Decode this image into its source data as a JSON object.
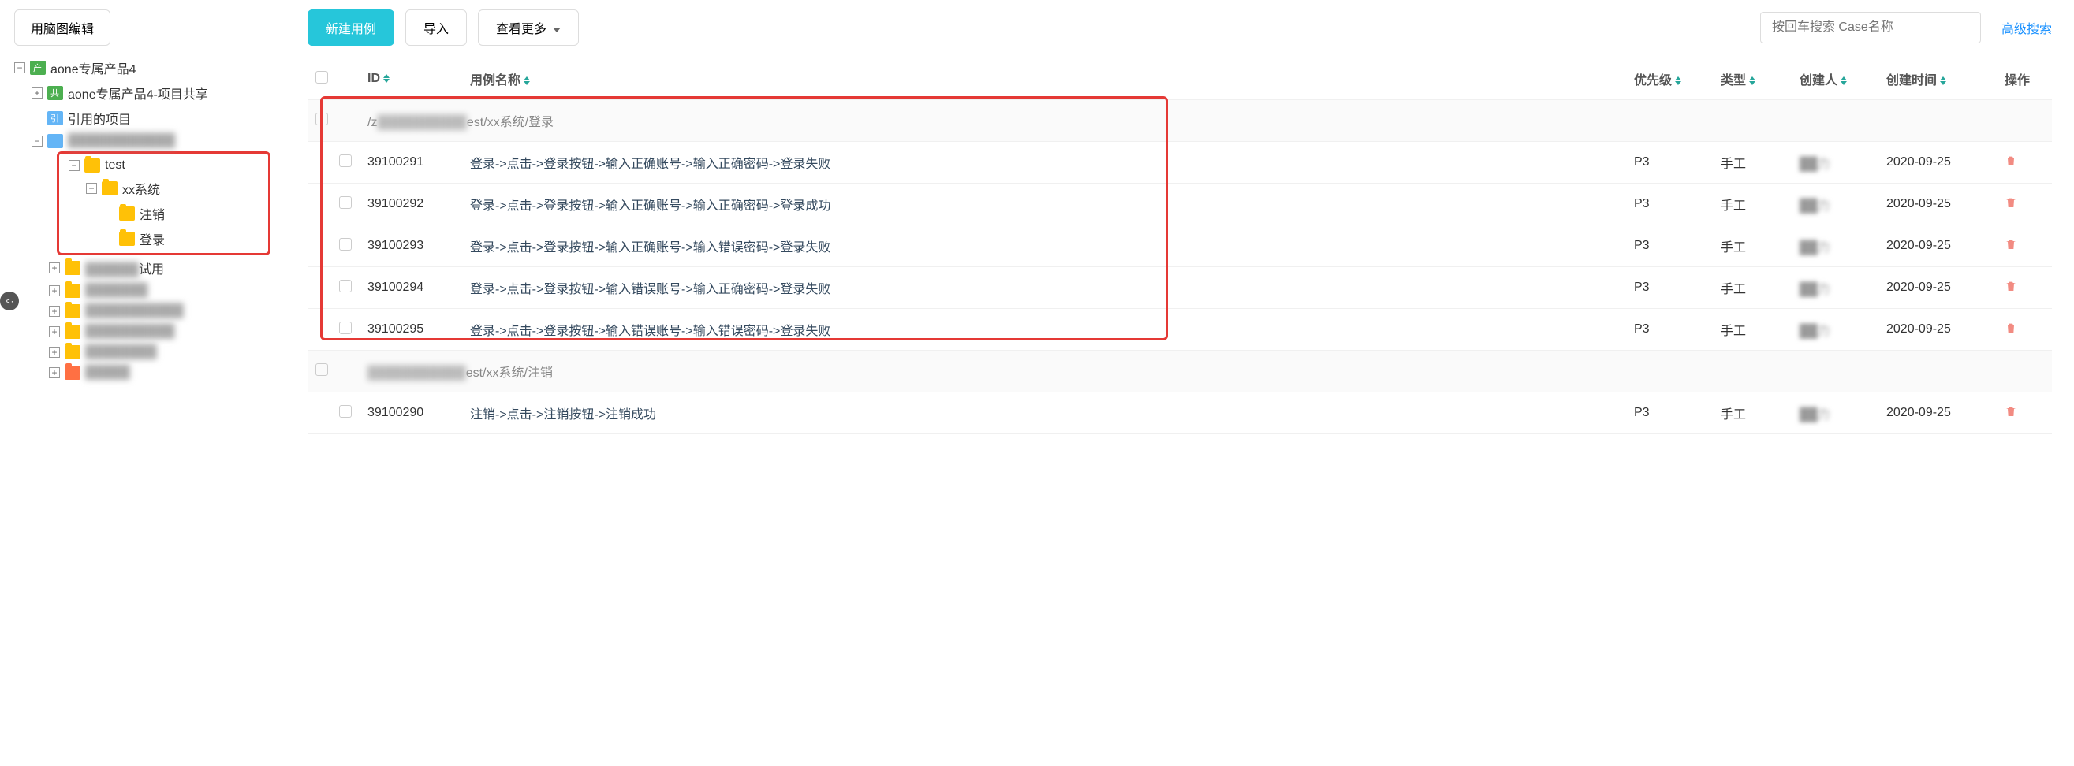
{
  "sidebar": {
    "mindmap_button": "用脑图编辑",
    "tree": {
      "root": "aone专属产品4",
      "share": "aone专属产品4-项目共享",
      "ref": "引用的项目",
      "blurred1": "████████████",
      "test": "test",
      "xxsys": "xx系统",
      "logout": "注销",
      "login": "登录",
      "other1_suffix": "试用",
      "blurred_others": [
        "███████",
        "███████████",
        "██████████",
        "████████",
        "█████"
      ]
    }
  },
  "toolbar": {
    "new_case": "新建用例",
    "import": "导入",
    "view_more": "查看更多",
    "search_placeholder": "按回车搜索 Case名称",
    "adv_search": "高级搜索"
  },
  "table": {
    "headers": {
      "id": "ID",
      "name": "用例名称",
      "priority": "优先级",
      "type": "类型",
      "creator": "创建人",
      "created_at": "创建时间",
      "op": "操作"
    },
    "groups": [
      {
        "path_prefix": "/z",
        "path_blurred": "██████████",
        "path_suffix": "est/xx系统/登录",
        "rows": [
          {
            "id": "39100291",
            "name": "登录->点击->登录按钮->输入正确账号->输入正确密码->登录失败",
            "priority": "P3",
            "type": "手工",
            "creator": "██力",
            "created_at": "2020-09-25"
          },
          {
            "id": "39100292",
            "name": "登录->点击->登录按钮->输入正确账号->输入正确密码->登录成功",
            "priority": "P3",
            "type": "手工",
            "creator": "██力",
            "created_at": "2020-09-25"
          },
          {
            "id": "39100293",
            "name": "登录->点击->登录按钮->输入正确账号->输入错误密码->登录失败",
            "priority": "P3",
            "type": "手工",
            "creator": "██力",
            "created_at": "2020-09-25"
          },
          {
            "id": "39100294",
            "name": "登录->点击->登录按钮->输入错误账号->输入正确密码->登录失败",
            "priority": "P3",
            "type": "手工",
            "creator": "██力",
            "created_at": "2020-09-25"
          },
          {
            "id": "39100295",
            "name": "登录->点击->登录按钮->输入错误账号->输入错误密码->登录失败",
            "priority": "P3",
            "type": "手工",
            "creator": "██力",
            "created_at": "2020-09-25"
          }
        ]
      },
      {
        "path_prefix": "",
        "path_blurred": "███████████",
        "path_suffix": "est/xx系统/注销",
        "rows": [
          {
            "id": "39100290",
            "name": "注销->点击->注销按钮->注销成功",
            "priority": "P3",
            "type": "手工",
            "creator": "██力",
            "created_at": "2020-09-25"
          }
        ]
      }
    ]
  },
  "side_tab": "<·"
}
